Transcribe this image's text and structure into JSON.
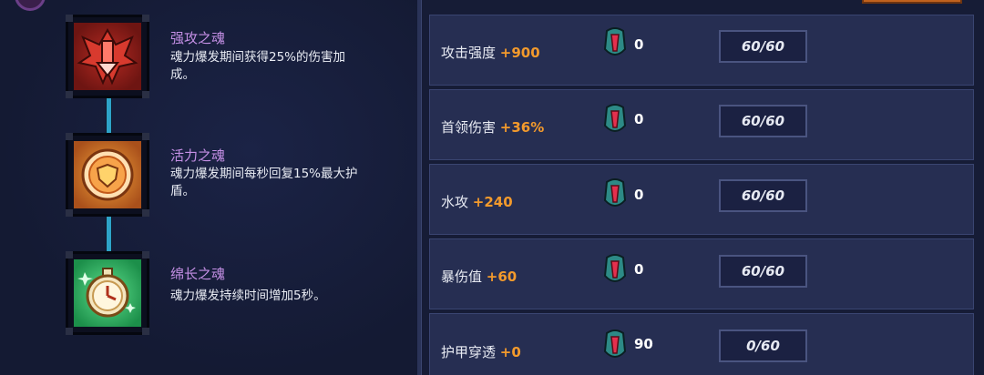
{
  "souls": [
    {
      "name": "强攻之魂",
      "desc_line1": "魂力爆发期间获得25%的伤害加",
      "desc_line2": "成。",
      "icon": "red-bat-icon"
    },
    {
      "name": "活力之魂",
      "desc_line1": "魂力爆发期间每秒回复15%最大护",
      "desc_line2": "盾。",
      "icon": "shield-heart-icon"
    },
    {
      "name": "绵长之魂",
      "desc_line1": "魂力爆发持续时间增加5秒。",
      "desc_line2": "",
      "icon": "stopwatch-icon"
    }
  ],
  "stats": [
    {
      "label": "攻击强度",
      "bonus": "+900",
      "gems": "0",
      "progress": "60/60"
    },
    {
      "label": "首领伤害",
      "bonus": "+36%",
      "gems": "0",
      "progress": "60/60"
    },
    {
      "label": "水攻",
      "bonus": "+240",
      "gems": "0",
      "progress": "60/60"
    },
    {
      "label": "暴伤值",
      "bonus": "+60",
      "gems": "0",
      "progress": "60/60"
    },
    {
      "label": "护甲穿透",
      "bonus": "+0",
      "gems": "90",
      "progress": "0/60"
    }
  ],
  "colors": {
    "background": "#141a33",
    "row_background": "#262e52",
    "soul_name": "#c590e6",
    "bonus": "#f39a2c",
    "connector": "#2ea3c8"
  }
}
